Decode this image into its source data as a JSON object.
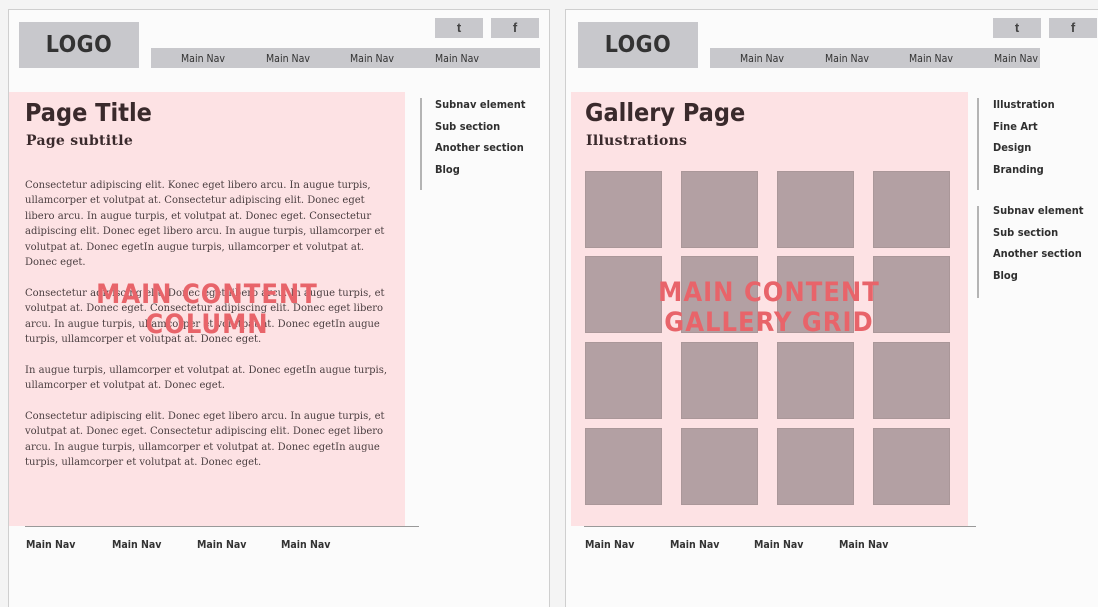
{
  "left": {
    "logo": "LOGO",
    "social": [
      "t",
      "f"
    ],
    "nav": [
      "Main Nav",
      "Main Nav",
      "Main Nav",
      "Main Nav"
    ],
    "title": "Page Title",
    "subtitle": "Page subtitle",
    "paragraphs": [
      "Consectetur adipiscing elit. Konec eget libero arcu. In augue turpis, ullamcorper et volutpat at. Consectetur adipiscing elit. Donec eget libero arcu. In augue turpis, et volutpat at. Donec eget. Consectetur adipiscing elit. Donec eget libero arcu. In augue turpis, ullamcorper et volutpat at. Donec egetIn augue turpis, ullamcorper et volutpat at. Donec eget.",
      "Consectetur adipiscing elit. Donec eget libero arcu. In augue turpis, et volutpat at. Donec eget. Consectetur adipiscing elit. Donec eget libero arcu. In augue turpis, ullamcorper et volutpat at. Donec egetIn augue turpis, ullamcorper et volutpat at. Donec eget.",
      "In augue turpis, ullamcorper et volutpat at. Donec egetIn augue turpis, ullamcorper et volutpat at. Donec eget.",
      "Consectetur adipiscing elit. Donec eget libero arcu. In augue turpis, et volutpat at. Donec eget. Consectetur adipiscing elit. Donec eget libero arcu. In augue turpis, ullamcorper et volutpat at. Donec egetIn augue turpis, ullamcorper et volutpat at. Donec eget."
    ],
    "overlay": [
      "MAIN CONTENT",
      "COLUMN"
    ],
    "subnav": [
      "Subnav element",
      "Sub section",
      "Another section",
      "Blog"
    ],
    "footer_nav": [
      "Main Nav",
      "Main Nav",
      "Main Nav",
      "Main Nav"
    ]
  },
  "right": {
    "logo": "LOGO",
    "social": [
      "t",
      "f"
    ],
    "nav": [
      "Main Nav",
      "Main Nav",
      "Main Nav",
      "Main Nav"
    ],
    "title": "Gallery Page",
    "subtitle": "Illustrations",
    "overlay": [
      "MAIN CONTENT",
      "GALLERY GRID"
    ],
    "categories": [
      "Illustration",
      "Fine Art",
      "Design",
      "Branding"
    ],
    "subnav": [
      "Subnav element",
      "Sub section",
      "Another section",
      "Blog"
    ],
    "footer_nav": [
      "Main Nav",
      "Main Nav",
      "Main Nav",
      "Main Nav"
    ]
  },
  "colors": {
    "content_bg": "#fde2e4",
    "overlay_text": "#e8646a",
    "thumbnail": "#b3a0a3",
    "placeholder_gray": "#c8c8cc"
  }
}
